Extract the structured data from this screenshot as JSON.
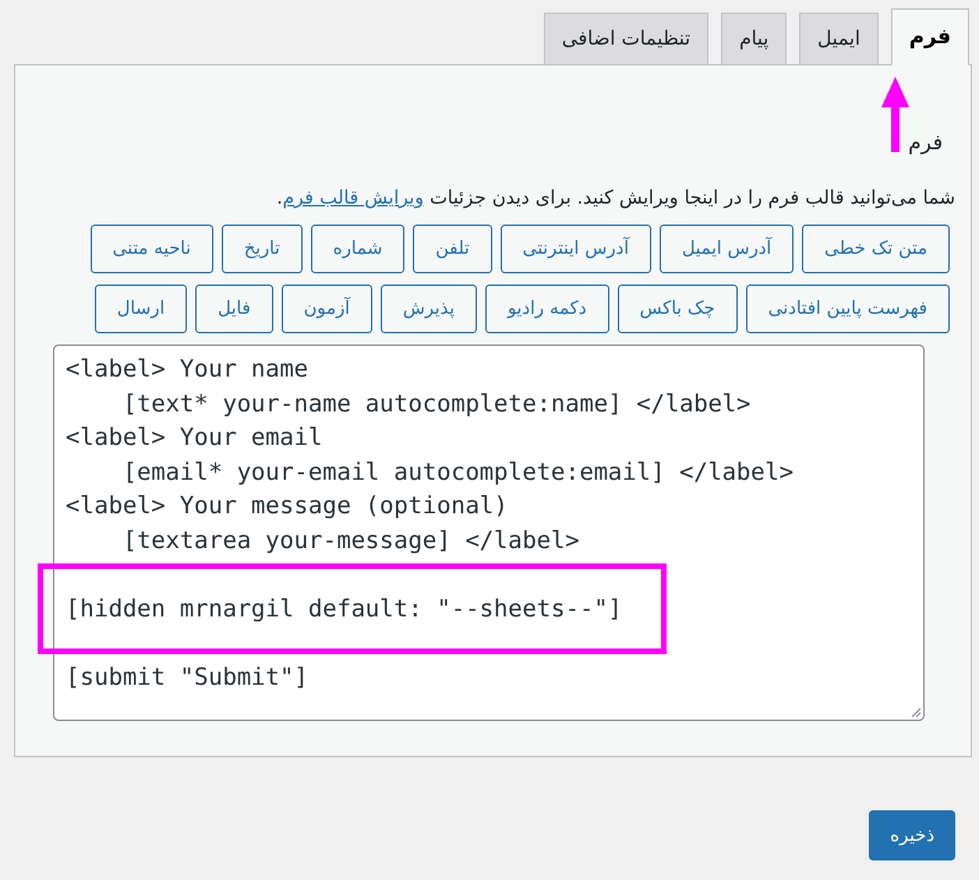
{
  "tabs": [
    {
      "label": "فرم",
      "selected": true
    },
    {
      "label": "ایمیل",
      "selected": false
    },
    {
      "label": "پیام",
      "selected": false
    },
    {
      "label": "تنظیمات اضافی",
      "selected": false
    }
  ],
  "panel": {
    "heading": "فرم",
    "description": {
      "before": "شما می‌توانید قالب فرم را در اینجا ویرایش کنید. برای دیدن جزئیات ",
      "link": "ویرایش قالب فرم",
      "after": "."
    },
    "tag_button_rows": [
      [
        "متن تک خطی",
        "آدرس ایمیل",
        "آدرس اینترنتی",
        "تلفن",
        "شماره",
        "تاریخ",
        "ناحیه متنی"
      ],
      [
        "فهرست پایین افتادنی",
        "چک باکس",
        "دکمه رادیو",
        "پذیرش",
        "آزمون",
        "فایل",
        "ارسال"
      ]
    ],
    "form_code": "<label> Your name\n    [text* your-name autocomplete:name] </label>\n<label> Your email\n    [email* your-email autocomplete:email] </label>\n<label> Your message (optional)\n    [textarea your-message] </label>\n\n[hidden mrnargil default: \"--sheets--\"]\n\n[submit \"Submit\"]"
  },
  "save_button": "ذخیره"
}
